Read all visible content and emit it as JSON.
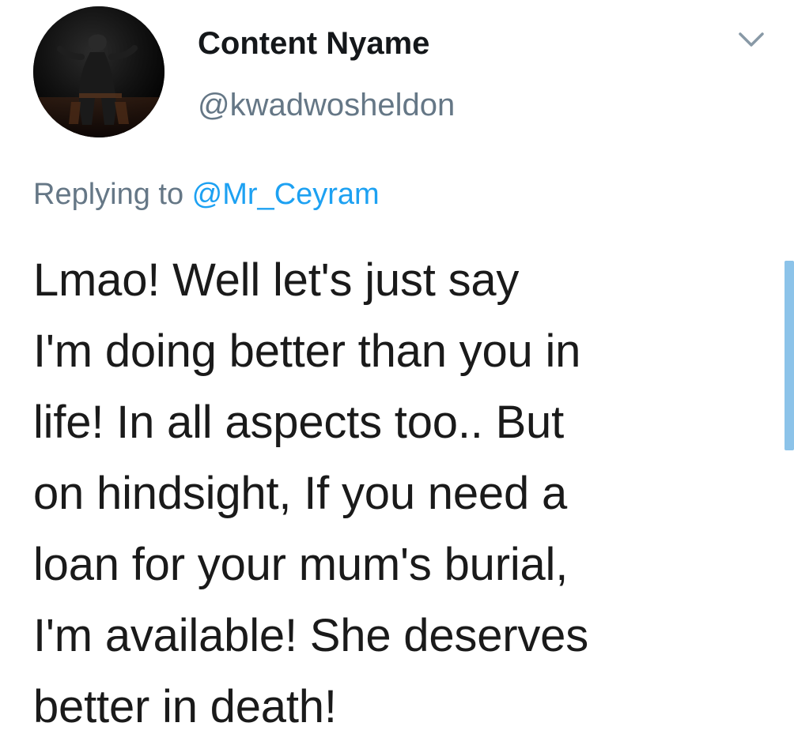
{
  "tweet": {
    "author": {
      "display_name": "Content Nyame",
      "handle": "@kwadwosheldon",
      "avatar_icon": "profile-photo-avatar"
    },
    "reply": {
      "prefix": "Replying to ",
      "mention": "@Mr_Ceyram"
    },
    "text": "Lmao! Well let's just say\nI'm doing better than you in\nlife! In all aspects too.. But\non hindsight, If you need a\nloan for your mum's burial,\nI'm available! She deserves\nbetter in death!",
    "menu_icon": "chevron-down-icon"
  },
  "colors": {
    "secondary_text": "#657786",
    "mention": "#1da1f2",
    "primary_text": "#14171a",
    "scroll_indicator": "#8cc3e9"
  }
}
